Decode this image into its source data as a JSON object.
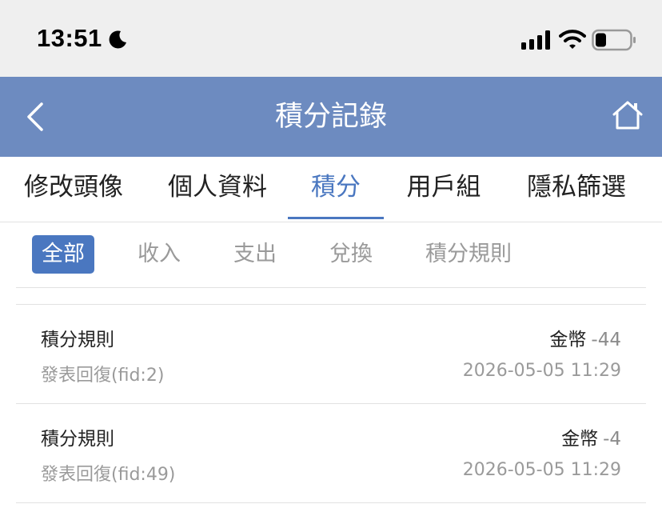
{
  "status_bar": {
    "time": "13:51",
    "icons": [
      "moon-icon",
      "signal-icon",
      "wifi-icon",
      "battery-icon"
    ]
  },
  "header": {
    "title": "積分記錄",
    "back_icon": "chevron-left-icon",
    "home_icon": "home-icon",
    "bg_color": "#6d8bc0"
  },
  "main_tabs": [
    {
      "label": "修改頭像"
    },
    {
      "label": "個人資料"
    },
    {
      "label": "積分",
      "active": true
    },
    {
      "label": "用戶組"
    },
    {
      "label": "隱私篩選"
    }
  ],
  "sub_tabs": [
    {
      "label": "全部",
      "active": true
    },
    {
      "label": "收入"
    },
    {
      "label": "支出"
    },
    {
      "label": "兌換"
    },
    {
      "label": "積分規則"
    }
  ],
  "records": [
    {
      "rule": "積分規則",
      "currency": "金幣",
      "delta": "-44",
      "desc": "發表回復(fid:2)",
      "time": "2026-05-05 11:29"
    },
    {
      "rule": "積分規則",
      "currency": "金幣",
      "delta": "-4",
      "desc": "發表回復(fid:49)",
      "time": "2026-05-05 11:29"
    }
  ],
  "colors": {
    "accent": "#4a77c0",
    "muted_text": "#9a9a9a"
  }
}
